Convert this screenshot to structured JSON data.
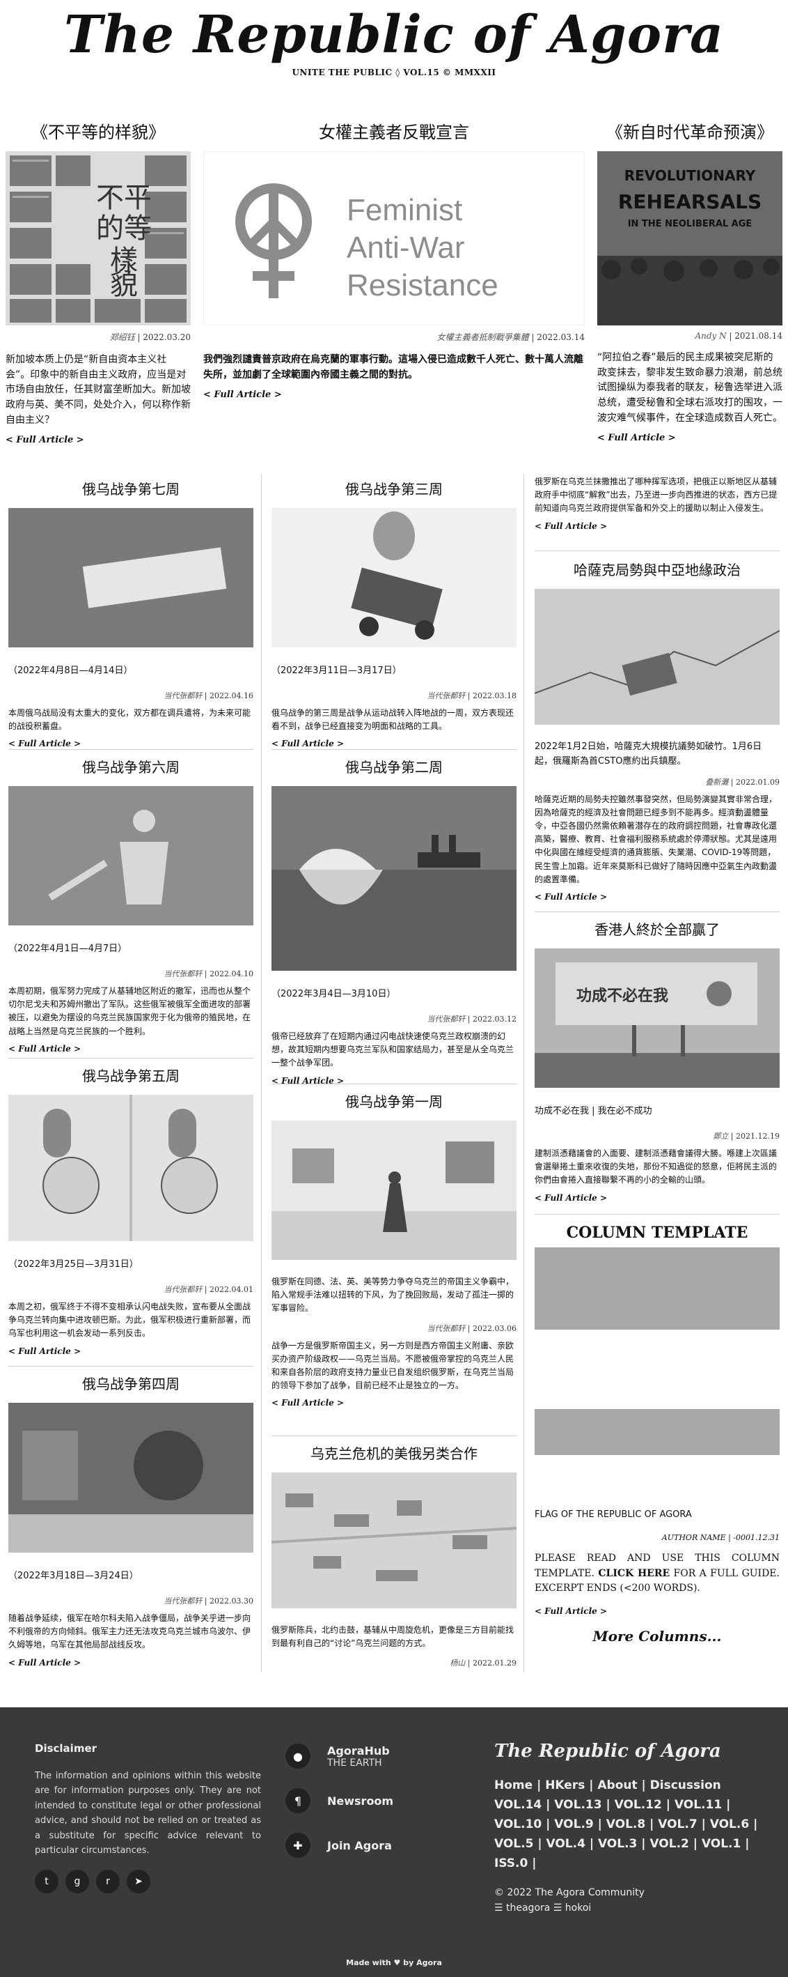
{
  "masthead": {
    "title": "The Republic of Agora",
    "tagline": "UNITE THE PUBLIC ◊ VOL.15 © MMXXII"
  },
  "featured": [
    {
      "title": "《不平等的样貌》",
      "author": "郑绍钰",
      "date": "2022.03.20",
      "excerpt": "新加坡本质上仍是“新自由资本主义社会”。印象中的新自由主义政府，应当是对市场自由放任，任其财富垄断加大。新加坡政府与英、美不同，处处介入，何以称作新自由主义？",
      "more": "< Full Article >",
      "image_text": [
        "不平",
        "的等",
        "樣",
        "貌"
      ]
    },
    {
      "title": "女權主義者反戰宣言",
      "author": "女權主義者抵制戰爭集體",
      "date": "2022.03.14",
      "excerpt": "我們強烈譴責普京政府在烏克蘭的軍事行動。這場入侵已造成數千人死亡、數十萬人流離失所，並加劇了全球範圍內帝國主義之間的對抗。",
      "more": "< Full Article >",
      "image_text": [
        "Feminist",
        "Anti-War",
        "Resistance"
      ]
    },
    {
      "title": "《新自时代革命预演》",
      "author": "Andy N",
      "date": "2021.08.14",
      "excerpt": "“阿拉伯之春”最后的民主成果被突尼斯的政变抹去，黎非发生致命暴力浪潮，前总统试图操纵为泰我者的联友，秘鲁选举进入派总统，遭受秘鲁和全球右派攻打的围攻，一波灾难气候事件，在全球造成数百人死亡。",
      "more": "< Full Article >",
      "image_text": [
        "REVOLUTIONARY",
        "REHEARSALS",
        "IN THE NEOLIBERAL AGE"
      ]
    }
  ],
  "column1": [
    {
      "title": "俄乌战争第七周",
      "subtitle": "（2022年4月8日—4月14日）",
      "author": "当代张都轩",
      "date": "2022.04.16",
      "excerpt": "本周俄乌战局没有太重大的变化，双方都在调兵遣将，为未来可能的战役积蓄盘。",
      "more": "< Full Article >"
    },
    {
      "title": "俄乌战争第六周",
      "subtitle": "（2022年4月1日—4月7日）",
      "author": "当代张都轩",
      "date": "2022.04.10",
      "excerpt": "本周初期，俄军努力完成了从基辅地区附近的撤军，迅而也从整个切尔尼戈夫和苏姆州撤出了军队。这些俄军被俄军全面进攻的部署被压，以避免为摆设的乌克兰民族国家兜于化为俄帝的殖民地，在战略上当然是乌克兰民族的一个胜利。",
      "more": "< Full Article >"
    },
    {
      "title": "俄乌战争第五周",
      "subtitle": "（2022年3月25日—3月31日）",
      "author": "当代张都轩",
      "date": "2022.04.01",
      "excerpt": "本周之初，俄军终于不得不变相承认闪电战失败，宣布要从全面战争乌克兰转向集中进攻顿巴斯。为此，俄军积极进行重新部署，而乌军也利用这一机会发动一系列反击。",
      "more": "< Full Article >"
    },
    {
      "title": "俄乌战争第四周",
      "subtitle": "（2022年3月18日—3月24日）",
      "author": "当代张都轩",
      "date": "2022.03.30",
      "excerpt": "随着战争延续，俄军在哈尔科夫陷入战争僵局，战争关乎进一步向不利俄帝的方向倾斜。俄军主力还无法攻克乌克兰城市乌波尔、伊久姆等地，乌军在其他局部战线反攻。",
      "more": "< Full Article >"
    }
  ],
  "column2": [
    {
      "title": "俄乌战争第三周",
      "subtitle": "（2022年3月11日—3月17日）",
      "author": "当代张都轩",
      "date": "2022.03.18",
      "excerpt": "俄乌战争的第三周是战争从运动战转入阵地战的一周，双方表现还看不到，战争已经直接变为明面和战略的工具。",
      "more": "< Full Article >"
    },
    {
      "title": "俄乌战争第二周",
      "subtitle": "（2022年3月4日—3月10日）",
      "author": "当代张都轩",
      "date": "2022.03.12",
      "excerpt": "俄帝已经放弃了在短期内通过闪电战快速使乌克兰政权崩溃的幻想，故其短期内想要乌克兰军队和国家结局力，甚至是从全乌克兰一整个战争军团。",
      "more": "< Full Article >"
    },
    {
      "title": "俄乌战争第一周",
      "subtitle": "俄罗斯在同德、法、英、美等势力争夺乌克兰的帝国主义争霸中，陷入常规手法难以扭转的下风，为了挽回败局，发动了孤注一掷的军事冒险。",
      "author": "当代张都轩",
      "date": "2022.03.06",
      "excerpt": "战争一方是俄罗斯帝国主义，另一方则是西方帝国主义附庸、亲欧买办资产阶级政权——乌克兰当局。不愿被俄帝掌控的乌克兰人民和来自各阶层的政府支持力量业已自发组织俄罗斯，在乌克兰当局的领导下参加了战争，目前已经不止是独立的一方。",
      "more": "< Full Article >"
    },
    {
      "title": "乌克兰危机的美俄另类合作",
      "subtitle": "俄罗斯陈兵，北约击鼓，基辅从中周旋危机，更像是三方目前能找到最有利自己的“讨论”乌克兰问题的方式。",
      "author": "杨山",
      "date": "2022.01.29"
    }
  ],
  "column3": [
    {
      "excerpt": "俄罗斯在乌克兰抹撒推出了哪种挥军选项，把俄正以斯地区从基辅政府手中彻底“解救”出去，乃至进一步向西推进的状态，西方已提前知道向乌克兰政府提供军备和外交上的援助以制止入侵发生。",
      "more": "< Full Article >"
    },
    {
      "title": "哈薩克局勢與中亞地緣政治",
      "subtitle": "2022年1月2日始，哈薩克大規模抗議勢如破竹。1月6日起，俄羅斯為首CSTO應約出兵鎮壓。",
      "author": "叠新灘",
      "date": "2022.01.09",
      "excerpt": "哈薩克近期的局勢夫控雖然事發突然，但局勢演變其實非常合理，因為哈薩克的經濟及社會問題已經多到不能再多。經濟動盪體量令，中亞各國仍然需依賴著潜存在的政府調控問題，社會專政化還高築，醫療、教育、社會福利服務系統處於停滯狀態。尤其是遠用中化與國在維經受經濟的通貨膨脹、失業潮、COVID-19等問題，民生雪上加霜。近年來莫斯科已做好了隨時因應中亞氣生內政動盪的處置準備。",
      "more": "< Full Article >"
    },
    {
      "title": "香港人終於全部贏了",
      "subtitle": "功成不必在我 | 我在必不成功",
      "author": "鄭立",
      "date": "2021.12.19",
      "excerpt": "建制派憑藉議會的入面要、建制派憑藉會議得大勝。喺建上次區議會選舉捲土重來收復的失地，那份不知過從的怒意，佢將民主派的你們由會捲入直接聯繫不再的小的全輸的山頭。",
      "more": "< Full Article >",
      "image_text": "功成不必在我"
    }
  ],
  "column_template": {
    "title": "COLUMN TEMPLATE",
    "caption": "FLAG OF THE REPUBLIC OF AGORA",
    "author": "AUTHOR NAME",
    "date": "-0001.12.31",
    "excerpt_prefix": "PLEASE READ AND USE THIS COLUMN TEMPLATE. ",
    "excerpt_link": "CLICK HERE",
    "excerpt_suffix": " FOR A FULL GUIDE. EXCERPT ENDS (<200 WORDS).",
    "more": "< Full Article >",
    "more_columns": "More Columns..."
  },
  "footer": {
    "disclaimer_title": "Disclaimer",
    "disclaimer_text": "The information and opinions within this website are for information purposes only. They are not intended to constitute legal or other professional advice, and should not be relied on or treated as a substitute for specific advice relevant to particular circumstances.",
    "links": [
      {
        "title": "AgoraHub",
        "sub": "THE EARTH",
        "icon": "location-icon"
      },
      {
        "title": "Newsroom",
        "sub": "",
        "icon": "paragraph-icon"
      },
      {
        "title": "Join Agora",
        "sub": "",
        "icon": "puzzle-icon"
      }
    ],
    "brand": "The Republic of Agora",
    "nav_text": "Home | HKers | About | Discussion VOL.14 | VOL.13 | VOL.12 | VOL.11 | VOL.10 | VOL.9 | VOL.8 | VOL.7 | VOL.6 | VOL.5 | VOL.4 | VOL.3 | VOL.2 | VOL.1 | ISS.0 |",
    "copyright": "© 2022 The Agora Community",
    "handles": "☰ theagora ☰ hokoi",
    "made_with": "Made with ♥ by Agora",
    "social_icons": [
      "twitter-icon",
      "github-icon",
      "reddit-icon",
      "telegram-icon"
    ]
  }
}
